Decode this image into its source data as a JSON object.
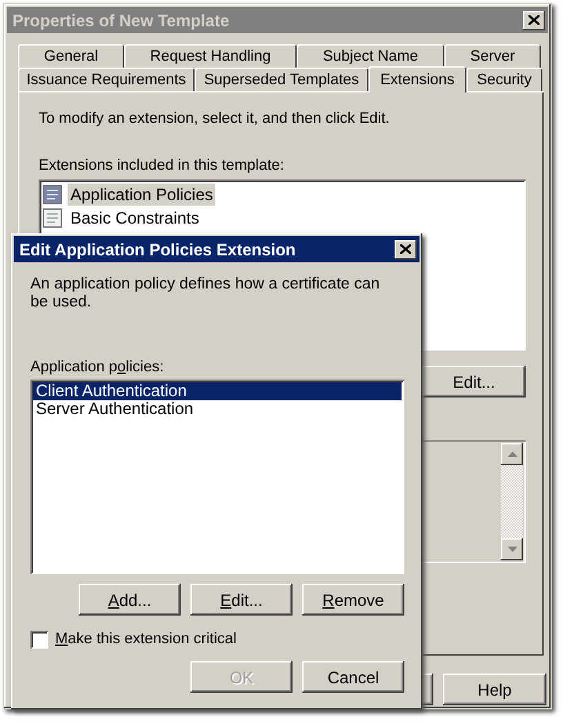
{
  "window": {
    "title": "Properties of New Template",
    "active": false
  },
  "tab_rows": [
    {
      "tabs": [
        {
          "label": "General",
          "selected": false
        },
        {
          "label": "Request Handling",
          "selected": false
        },
        {
          "label": "Subject Name",
          "selected": false
        },
        {
          "label": "Server",
          "selected": false
        }
      ]
    },
    {
      "tabs": [
        {
          "label": "Issuance Requirements",
          "selected": false
        },
        {
          "label": "Superseded Templates",
          "selected": false
        },
        {
          "label": "Extensions",
          "selected": true
        },
        {
          "label": "Security",
          "selected": false
        }
      ]
    }
  ],
  "instructions": "To modify an extension, select it, and then click Edit.",
  "extensions_label": "Extensions included in this template:",
  "extensions": [
    {
      "label": "Application Policies",
      "selected": true
    },
    {
      "label": "Basic Constraints",
      "selected": false
    }
  ],
  "edit_button": "Edit...",
  "help_button": "Help",
  "dialog": {
    "title": "Edit Application Policies Extension",
    "active": true,
    "description": "An application policy defines how a certificate can be used.",
    "policies_label": [
      {
        "text": "Application p",
        "underline": false
      },
      {
        "text": "o",
        "underline": true
      },
      {
        "text": "licies:",
        "underline": false
      }
    ],
    "policies": [
      {
        "label": "Client Authentication",
        "selected": true
      },
      {
        "label": "Server Authentication",
        "selected": false
      }
    ],
    "buttons": [
      {
        "parts": [
          {
            "text": "A",
            "underline": true
          },
          {
            "text": "dd...",
            "underline": false
          }
        ],
        "disabled": false
      },
      {
        "parts": [
          {
            "text": "E",
            "underline": true
          },
          {
            "text": "dit...",
            "underline": false
          }
        ],
        "disabled": false
      },
      {
        "parts": [
          {
            "text": "R",
            "underline": true
          },
          {
            "text": "emove",
            "underline": false
          }
        ],
        "disabled": false
      }
    ],
    "critical": {
      "parts": [
        {
          "text": "M",
          "underline": true
        },
        {
          "text": "ake this extension critical",
          "underline": false
        }
      ],
      "checked": false
    },
    "footer_buttons": [
      {
        "parts": [
          {
            "text": "OK",
            "underline": false
          }
        ],
        "disabled": true
      },
      {
        "parts": [
          {
            "text": "Cancel",
            "underline": false
          }
        ],
        "disabled": false
      }
    ]
  }
}
